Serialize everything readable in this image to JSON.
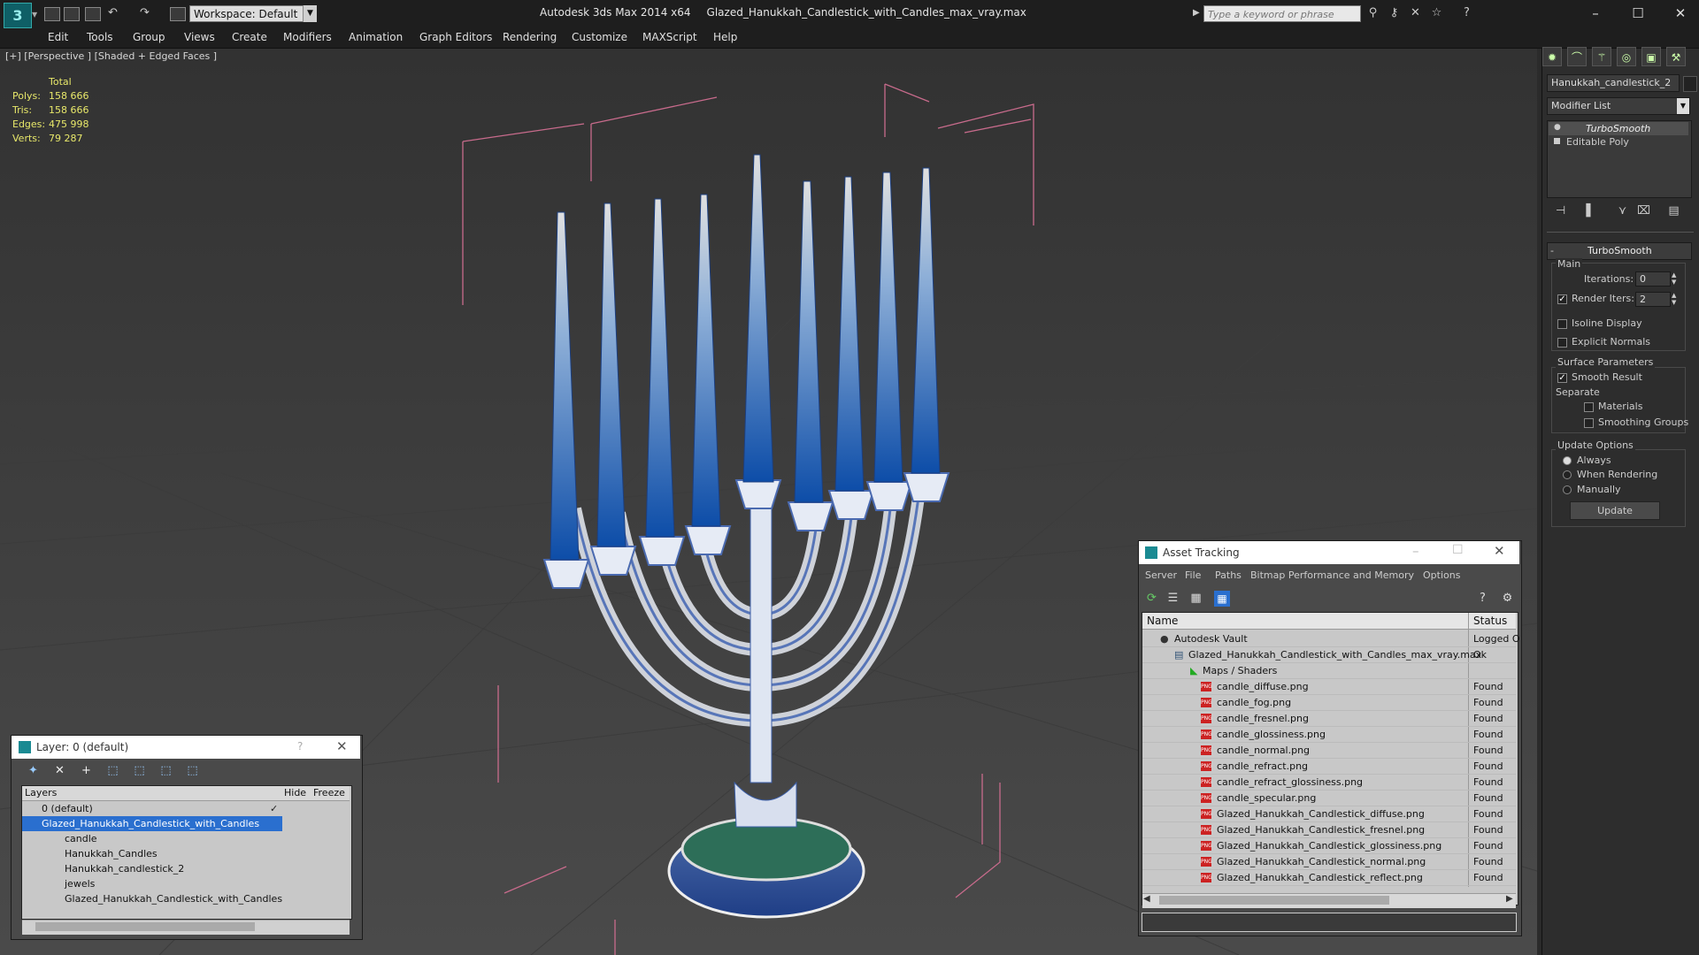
{
  "app": {
    "title": "Autodesk 3ds Max 2014 x64",
    "filename": "Glazed_Hanukkah_Candlestick_with_Candles_max_vray.max",
    "workspace": "Workspace: Default",
    "search_placeholder": "Type a keyword or phrase"
  },
  "menu": [
    "Edit",
    "Tools",
    "Group",
    "Views",
    "Create",
    "Modifiers",
    "Animation",
    "Graph Editors",
    "Rendering",
    "Customize",
    "MAXScript",
    "Help"
  ],
  "viewport": {
    "label": "[+] [Perspective ] [Shaded + Edged Faces ]",
    "stats_header": "Total",
    "stats": [
      {
        "label": "Polys:",
        "value": "158 666"
      },
      {
        "label": "Tris:",
        "value": "158 666"
      },
      {
        "label": "Edges:",
        "value": "475 998"
      },
      {
        "label": "Verts:",
        "value": "79 287"
      }
    ]
  },
  "command_panel": {
    "object_name": "Hanukkah_candlestick_2",
    "modifier_list": "Modifier List",
    "stack": [
      "TurboSmooth",
      "Editable Poly"
    ],
    "rollout_title": "TurboSmooth",
    "main_label": "Main",
    "iterations_label": "Iterations:",
    "iterations_value": "0",
    "render_iters_label": "Render Iters:",
    "render_iters_value": "2",
    "isoline": "Isoline Display",
    "explicit_normals": "Explicit Normals",
    "surface_params": "Surface Parameters",
    "smooth_result": "Smooth Result",
    "separate": "Separate",
    "materials": "Materials",
    "smoothing_groups": "Smoothing Groups",
    "update_options": "Update Options",
    "always": "Always",
    "when_rendering": "When Rendering",
    "manually": "Manually",
    "update_button": "Update"
  },
  "layer_window": {
    "title": "Layer: 0 (default)",
    "help": "?",
    "col_layers": "Layers",
    "col_hide": "Hide",
    "col_freeze": "Freeze",
    "rows": [
      {
        "name": "0 (default)",
        "indent": 1
      },
      {
        "name": "Glazed_Hanukkah_Candlestick_with_Candles",
        "indent": 1
      },
      {
        "name": "candle",
        "indent": 2
      },
      {
        "name": "Hanukkah_Candles",
        "indent": 2
      },
      {
        "name": "Hanukkah_candlestick_2",
        "indent": 2
      },
      {
        "name": "jewels",
        "indent": 2
      },
      {
        "name": "Glazed_Hanukkah_Candlestick_with_Candles",
        "indent": 2
      }
    ]
  },
  "asset_window": {
    "title": "Asset Tracking",
    "menu": [
      "Server",
      "File",
      "Paths",
      "Bitmap Performance and Memory",
      "Options"
    ],
    "col_name": "Name",
    "col_status": "Status",
    "rows": [
      {
        "name": "Autodesk Vault",
        "status": "Logged O",
        "level": 0,
        "kind": "vault"
      },
      {
        "name": "Glazed_Hanukkah_Candlestick_with_Candles_max_vray.max",
        "status": "Ok",
        "level": 1,
        "kind": "max"
      },
      {
        "name": "Maps / Shaders",
        "status": "",
        "level": 2,
        "kind": "folder"
      },
      {
        "name": "candle_diffuse.png",
        "status": "Found",
        "level": 3,
        "kind": "png"
      },
      {
        "name": "candle_fog.png",
        "status": "Found",
        "level": 3,
        "kind": "png"
      },
      {
        "name": "candle_fresnel.png",
        "status": "Found",
        "level": 3,
        "kind": "png"
      },
      {
        "name": "candle_glossiness.png",
        "status": "Found",
        "level": 3,
        "kind": "png"
      },
      {
        "name": "candle_normal.png",
        "status": "Found",
        "level": 3,
        "kind": "png"
      },
      {
        "name": "candle_refract.png",
        "status": "Found",
        "level": 3,
        "kind": "png"
      },
      {
        "name": "candle_refract_glossiness.png",
        "status": "Found",
        "level": 3,
        "kind": "png"
      },
      {
        "name": "candle_specular.png",
        "status": "Found",
        "level": 3,
        "kind": "png"
      },
      {
        "name": "Glazed_Hanukkah_Candlestick_diffuse.png",
        "status": "Found",
        "level": 3,
        "kind": "png"
      },
      {
        "name": "Glazed_Hanukkah_Candlestick_fresnel.png",
        "status": "Found",
        "level": 3,
        "kind": "png"
      },
      {
        "name": "Glazed_Hanukkah_Candlestick_glossiness.png",
        "status": "Found",
        "level": 3,
        "kind": "png"
      },
      {
        "name": "Glazed_Hanukkah_Candlestick_normal.png",
        "status": "Found",
        "level": 3,
        "kind": "png"
      },
      {
        "name": "Glazed_Hanukkah_Candlestick_reflect.png",
        "status": "Found",
        "level": 3,
        "kind": "png"
      }
    ]
  }
}
